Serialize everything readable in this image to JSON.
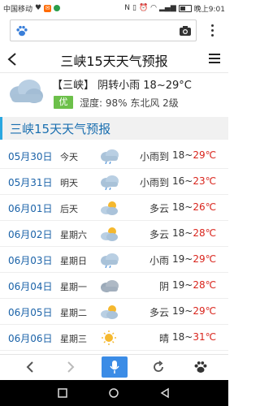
{
  "status": {
    "carrier": "中国移动",
    "time": "晚上9:01"
  },
  "header": {
    "title": "三峡15天天气预报"
  },
  "current": {
    "city": "【三峡】",
    "summary": "阴转小雨 18~29°C",
    "aqi": "优",
    "details": "湿度: 98%  东北风 2级"
  },
  "section": {
    "title": "三峡15天天气预报"
  },
  "forecast": [
    {
      "date": "05月30日",
      "weekday": "今天",
      "icon": "cloud-rain-icon",
      "desc": "小雨到",
      "lo": "18~",
      "hi": "29℃"
    },
    {
      "date": "05月31日",
      "weekday": "明天",
      "icon": "cloud-rain-icon",
      "desc": "小雨到",
      "lo": "16~",
      "hi": "23℃"
    },
    {
      "date": "06月01日",
      "weekday": "后天",
      "icon": "partly-cloudy-icon",
      "desc": "多云",
      "lo": "18~",
      "hi": "26℃"
    },
    {
      "date": "06月02日",
      "weekday": "星期六",
      "icon": "partly-cloudy-icon",
      "desc": "多云",
      "lo": "18~",
      "hi": "28℃"
    },
    {
      "date": "06月03日",
      "weekday": "星期日",
      "icon": "cloud-rain-icon",
      "desc": "小雨",
      "lo": "19~",
      "hi": "29℃"
    },
    {
      "date": "06月04日",
      "weekday": "星期一",
      "icon": "overcast-icon",
      "desc": "阴",
      "lo": "19~",
      "hi": "28℃"
    },
    {
      "date": "06月05日",
      "weekday": "星期二",
      "icon": "partly-cloudy-icon",
      "desc": "多云",
      "lo": "19~",
      "hi": "29℃"
    },
    {
      "date": "06月06日",
      "weekday": "星期三",
      "icon": "sunny-icon",
      "desc": "晴",
      "lo": "18~",
      "hi": "31℃"
    }
  ],
  "colors": {
    "accent": "#2aa7e0",
    "date_blue": "#1a62a8",
    "hi_red": "#d9241c",
    "aqi_green": "#6cc04a",
    "mic_blue": "#3b8ce6"
  }
}
